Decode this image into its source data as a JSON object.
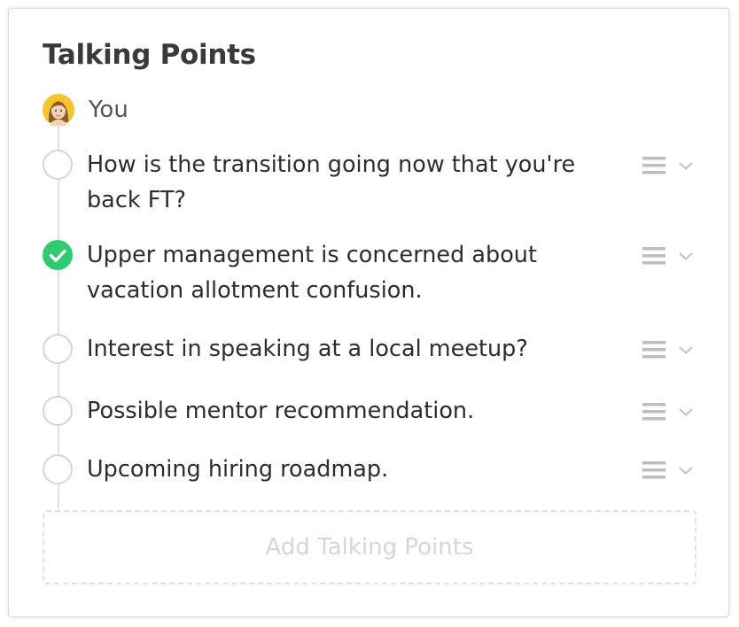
{
  "header": {
    "title": "Talking Points"
  },
  "owner": {
    "name": "You",
    "avatar": "female-avatar"
  },
  "colors": {
    "check_done": "#2ecc71",
    "check_border": "#d5d5d5",
    "timeline": "#e2e2e2"
  },
  "items": [
    {
      "text": "How is the transition going now that you're back FT?",
      "done": false
    },
    {
      "text": "Upper management is concerned about vacation allotment confusion.",
      "done": true
    },
    {
      "text": "Interest in speaking at a local meetup?",
      "done": false
    },
    {
      "text": "Possible mentor recommendation.",
      "done": false
    },
    {
      "text": "Upcoming hiring roadmap.",
      "done": false
    }
  ],
  "icons": {
    "reorder": "drag-handle-icon",
    "expand": "chevron-down-icon",
    "done": "checkmark-icon"
  },
  "add_button": {
    "label": "Add Talking Points"
  }
}
